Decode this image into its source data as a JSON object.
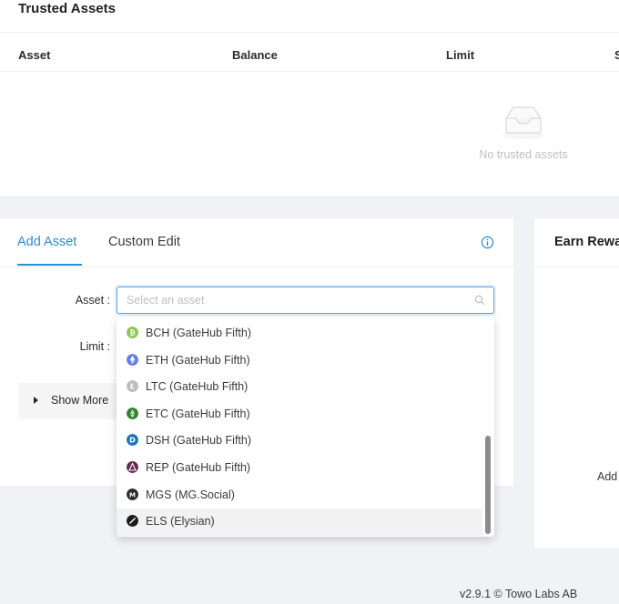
{
  "trusted_assets": {
    "title": "Trusted Assets",
    "columns": [
      "Asset",
      "Balance",
      "Limit",
      "S"
    ],
    "empty_text": "No trusted assets"
  },
  "add_asset": {
    "tabs": [
      "Add Asset",
      "Custom Edit"
    ],
    "active_tab": "Add Asset",
    "asset_label": "Asset :",
    "limit_label": "Limit :",
    "select_placeholder": "Select an asset",
    "show_more_label": "Show More",
    "options": [
      {
        "label": "BCH (GateHub Fifth)",
        "icon": "bch-coin-icon",
        "color": "#8dc351"
      },
      {
        "label": "ETH (GateHub Fifth)",
        "icon": "eth-coin-icon",
        "color": "#627eea"
      },
      {
        "label": "LTC (GateHub Fifth)",
        "icon": "ltc-coin-icon",
        "color": "#bfbbbb"
      },
      {
        "label": "ETC (GateHub Fifth)",
        "icon": "etc-coin-icon",
        "color": "#328332"
      },
      {
        "label": "DSH (GateHub Fifth)",
        "icon": "dash-coin-icon",
        "color": "#1c75bc"
      },
      {
        "label": "REP (GateHub Fifth)",
        "icon": "rep-coin-icon",
        "color": "#602a52"
      },
      {
        "label": "MGS (MG.Social)",
        "icon": "mgs-coin-icon",
        "color": "#2b2b2b"
      },
      {
        "label": "ELS (Elysian)",
        "icon": "els-coin-icon",
        "color": "#1a1a1a"
      }
    ],
    "hovered_option": "ELS (Elysian)"
  },
  "earn_rewards": {
    "title": "Earn Rewa",
    "add_text": "Add"
  },
  "footer": {
    "version": "v2.9.1 © Towo Labs AB"
  },
  "colors": {
    "accent": "#2f8ccf",
    "background": "#f0f2f5"
  }
}
